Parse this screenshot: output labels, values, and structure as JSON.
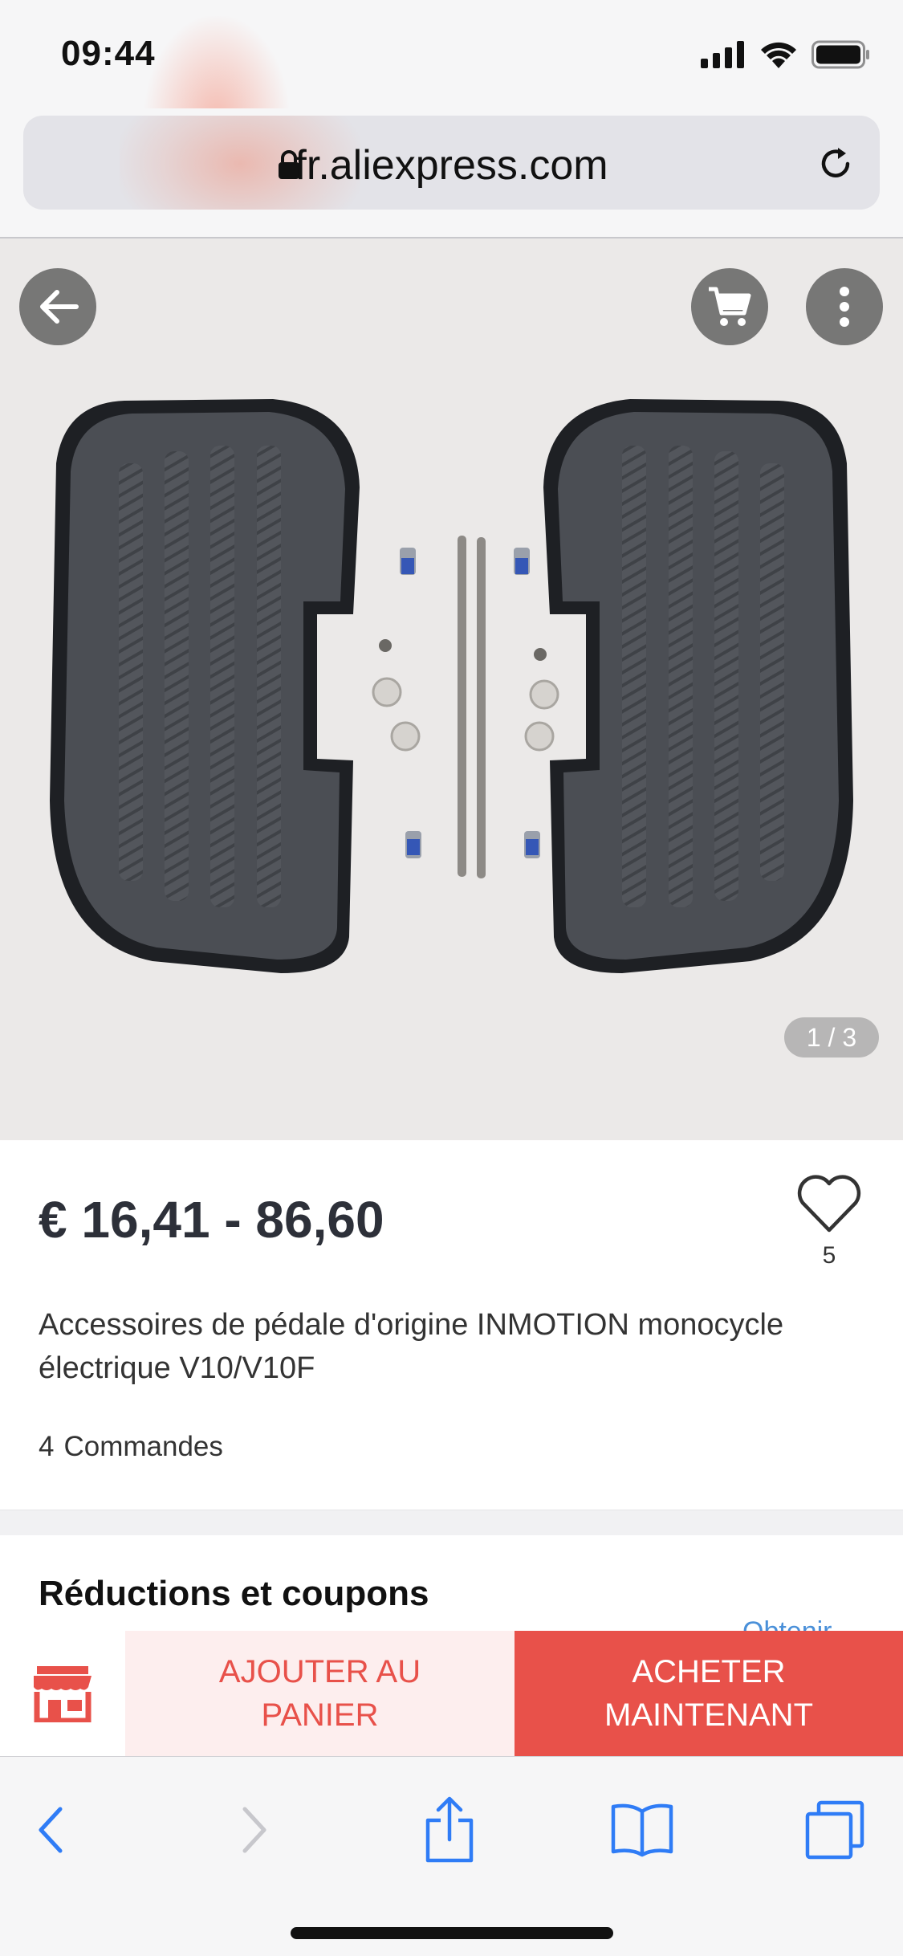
{
  "status_bar": {
    "time": "09:44"
  },
  "address_bar": {
    "domain": "fr.aliexpress.com"
  },
  "gallery": {
    "counter": "1 / 3"
  },
  "product": {
    "price": "€ 16,41 - 86,60",
    "wishlist_count": "5",
    "title": "Accessoires de pédale d'origine INMOTION monocycle électrique V10/V10F",
    "orders_count": "4",
    "orders_label": "Commandes"
  },
  "coupons": {
    "heading": "Réductions et coupons",
    "action_label": "Obtenir"
  },
  "actions": {
    "add_to_cart": "AJOUTER AU\nPANIER",
    "buy_now": "ACHETER\nMAINTENANT"
  },
  "colors": {
    "accent_red": "#e8514a",
    "cart_bg": "#fdeeee",
    "ios_blue": "#2f7cf6",
    "link_blue": "#4a90d9"
  },
  "icons": {
    "back": "arrow-left-icon",
    "cart": "shopping-cart-icon",
    "more": "more-vertical-icon",
    "wishlist": "heart-icon",
    "store": "store-icon",
    "lock": "lock-icon",
    "reload": "reload-icon"
  }
}
